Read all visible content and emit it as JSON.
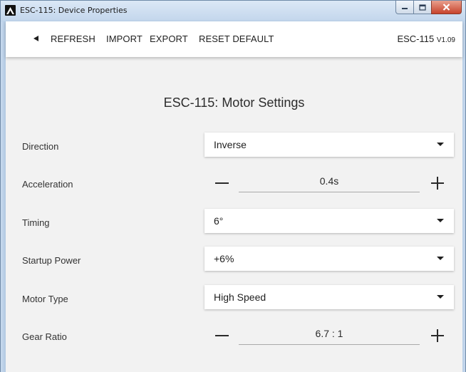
{
  "window": {
    "title": "ESC-115: Device Properties"
  },
  "toolbar": {
    "back_icon": "back-arrow-icon",
    "refresh_label": "REFRESH",
    "import_label": "IMPORT",
    "export_label": "EXPORT",
    "reset_label": "RESET DEFAULT",
    "device_name": "ESC-115",
    "device_version": "V1.09"
  },
  "main": {
    "heading": "ESC-115: Motor Settings",
    "settings": {
      "direction": {
        "label": "Direction",
        "value": "Inverse"
      },
      "acceleration": {
        "label": "Acceleration",
        "value": "0.4s"
      },
      "timing": {
        "label": "Timing",
        "value": "6°"
      },
      "startup_power": {
        "label": "Startup Power",
        "value": "+6%"
      },
      "motor_type": {
        "label": "Motor Type",
        "value": "High Speed"
      },
      "gear_ratio": {
        "label": "Gear Ratio",
        "value": "6.7 : 1"
      }
    }
  },
  "colors": {
    "close_button": "#c7432c",
    "content_background": "#f2f2f2",
    "titlebar": "#c3d6ec"
  }
}
